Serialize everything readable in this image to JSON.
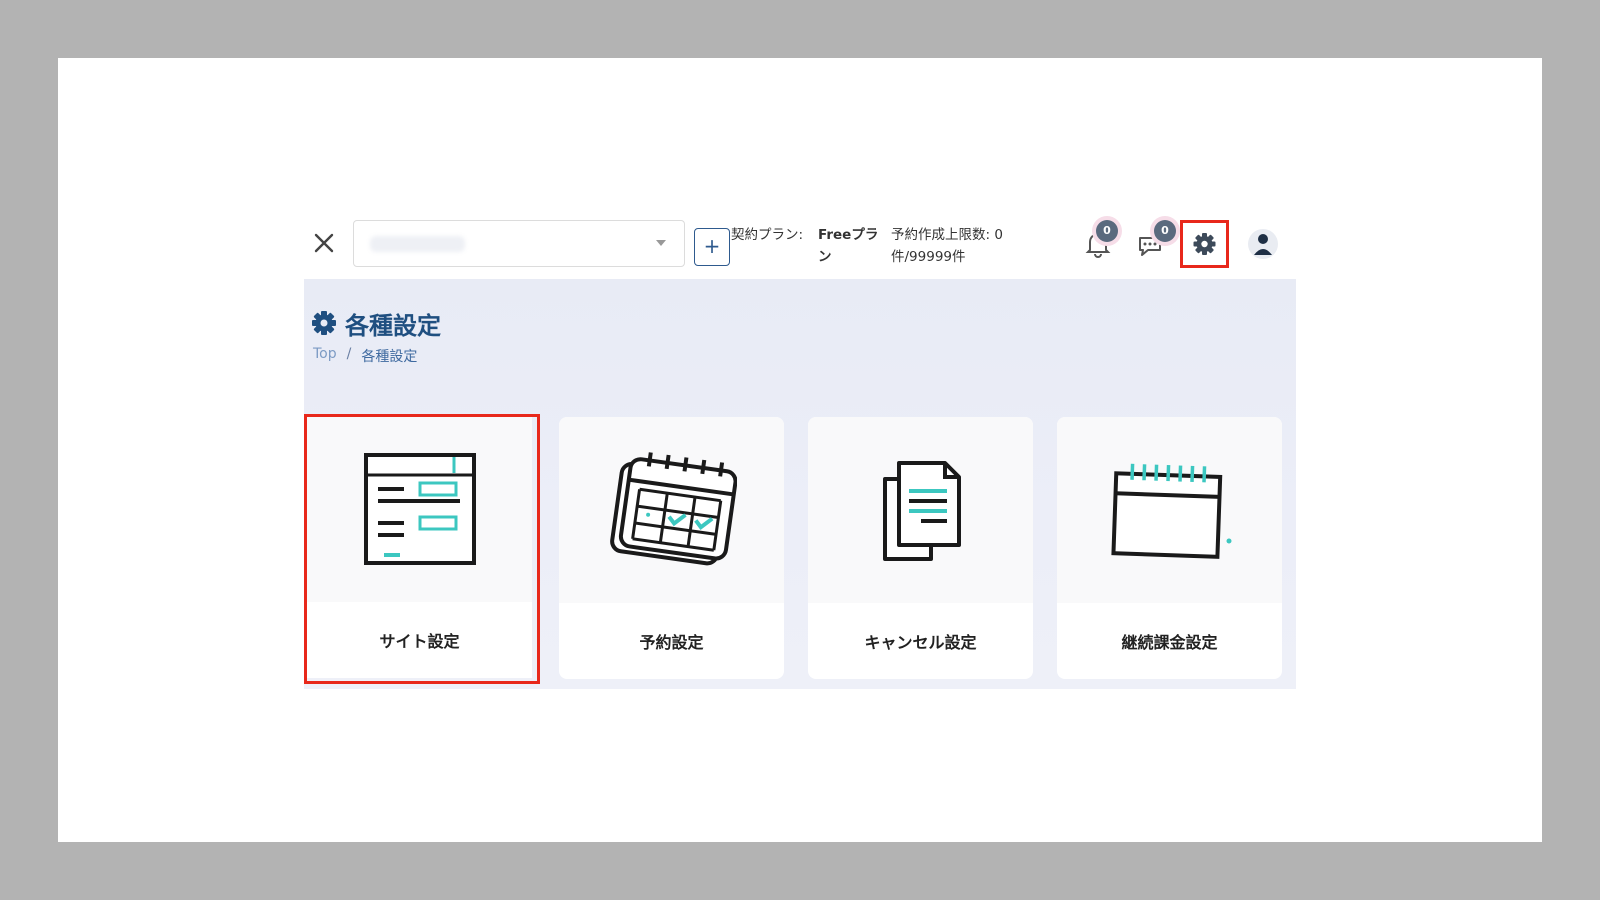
{
  "header": {
    "site_select": {
      "value": ""
    },
    "add_label": "+",
    "plan_label": "契約プラン:",
    "plan_value": "Freeプラン",
    "limit_text": "予約作成上限数: 0件/99999件",
    "notifications_count": "0",
    "messages_count": "0"
  },
  "page": {
    "title": "各種設定",
    "breadcrumb": {
      "top": "Top",
      "separator": "/",
      "current": "各種設定"
    }
  },
  "cards": [
    {
      "label": "サイト設定",
      "icon": "site-settings-icon",
      "highlighted": true
    },
    {
      "label": "予約設定",
      "icon": "calendar-check-icon",
      "highlighted": false
    },
    {
      "label": "キャンセル設定",
      "icon": "documents-icon",
      "highlighted": false
    },
    {
      "label": "継続課金設定",
      "icon": "calendar-icon",
      "highlighted": false
    }
  ],
  "colors": {
    "accent": "#1f4f80",
    "highlight": "#e8281b",
    "teal": "#3cc7c0"
  }
}
